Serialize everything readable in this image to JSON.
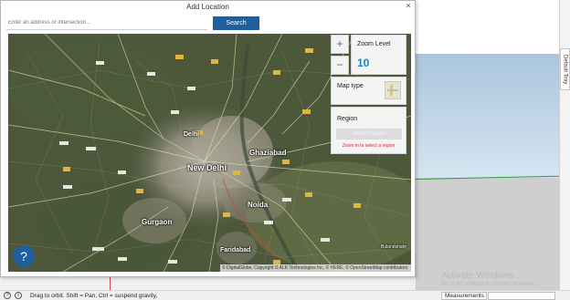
{
  "dialog": {
    "title": "Add Location",
    "close_glyph": "×",
    "search_placeholder": "Enter an address or intersection...",
    "search_button": "Search"
  },
  "map": {
    "zoom_in_glyph": "+",
    "zoom_out_glyph": "−",
    "zoom_label": "Zoom Level",
    "zoom_value": "10",
    "map_type_label": "Map type",
    "region_label": "Region",
    "region_button": "Select Region",
    "region_hint": "Zoom in to select a region",
    "help_glyph": "?",
    "attribution": "© DigitalGlobe, Copyright © ALK Technologies Inc, © HERE, © OpenStreetMap contributors",
    "places": [
      "New Delhi",
      "Ghaziabad",
      "Noida",
      "Gurgaon",
      "Faridabad",
      "Bulandshahr",
      "Delhi"
    ]
  },
  "viewport": {
    "default_tray_label": "Default Tray",
    "watermark_title": "Activate Windows",
    "watermark_sub": "Go to PC settings to activate Windows."
  },
  "statusbar": {
    "hint": "Drag to orbit. Shift = Pan, Ctrl = suspend gravity.",
    "measurements_label": "Measurements"
  },
  "colors": {
    "accent": "#1f5f9e",
    "zoom_value": "#1a84c7",
    "hint_red": "#d0262f"
  },
  "icons": [
    "close-icon",
    "help-icon",
    "zoom-in-icon",
    "zoom-out-icon",
    "info-icon",
    "map-type-thumbnail"
  ]
}
